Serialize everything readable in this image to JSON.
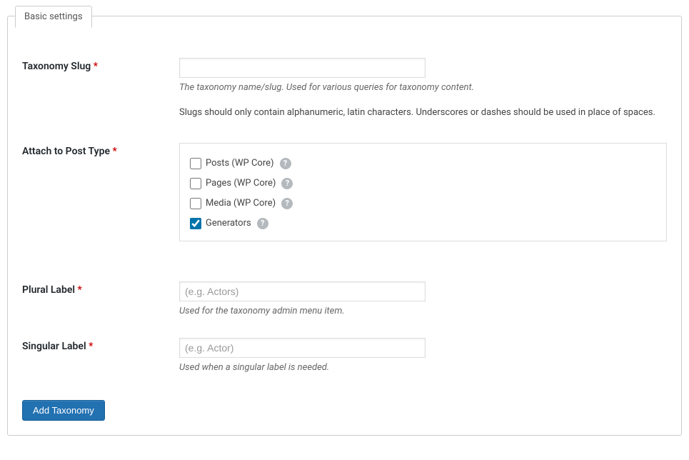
{
  "tab": {
    "label": "Basic settings"
  },
  "fields": {
    "taxonomy_slug": {
      "label": "Taxonomy Slug",
      "required": "*",
      "value": "",
      "desc_italic": "The taxonomy name/slug. Used for various queries for taxonomy content.",
      "desc_plain": "Slugs should only contain alphanumeric, latin characters. Underscores or dashes should be used in place of spaces."
    },
    "attach_post_type": {
      "label": "Attach to Post Type",
      "required": "*",
      "options": [
        {
          "label": "Posts (WP Core)",
          "checked": false
        },
        {
          "label": "Pages (WP Core)",
          "checked": false
        },
        {
          "label": "Media (WP Core)",
          "checked": false
        },
        {
          "label": "Generators",
          "checked": true
        }
      ]
    },
    "plural_label": {
      "label": "Plural Label",
      "required": "*",
      "placeholder": "(e.g. Actors)",
      "value": "",
      "desc_italic": "Used for the taxonomy admin menu item."
    },
    "singular_label": {
      "label": "Singular Label",
      "required": "*",
      "placeholder": "(e.g. Actor)",
      "value": "",
      "desc_italic": "Used when a singular label is needed."
    }
  },
  "submit": {
    "label": "Add Taxonomy"
  }
}
